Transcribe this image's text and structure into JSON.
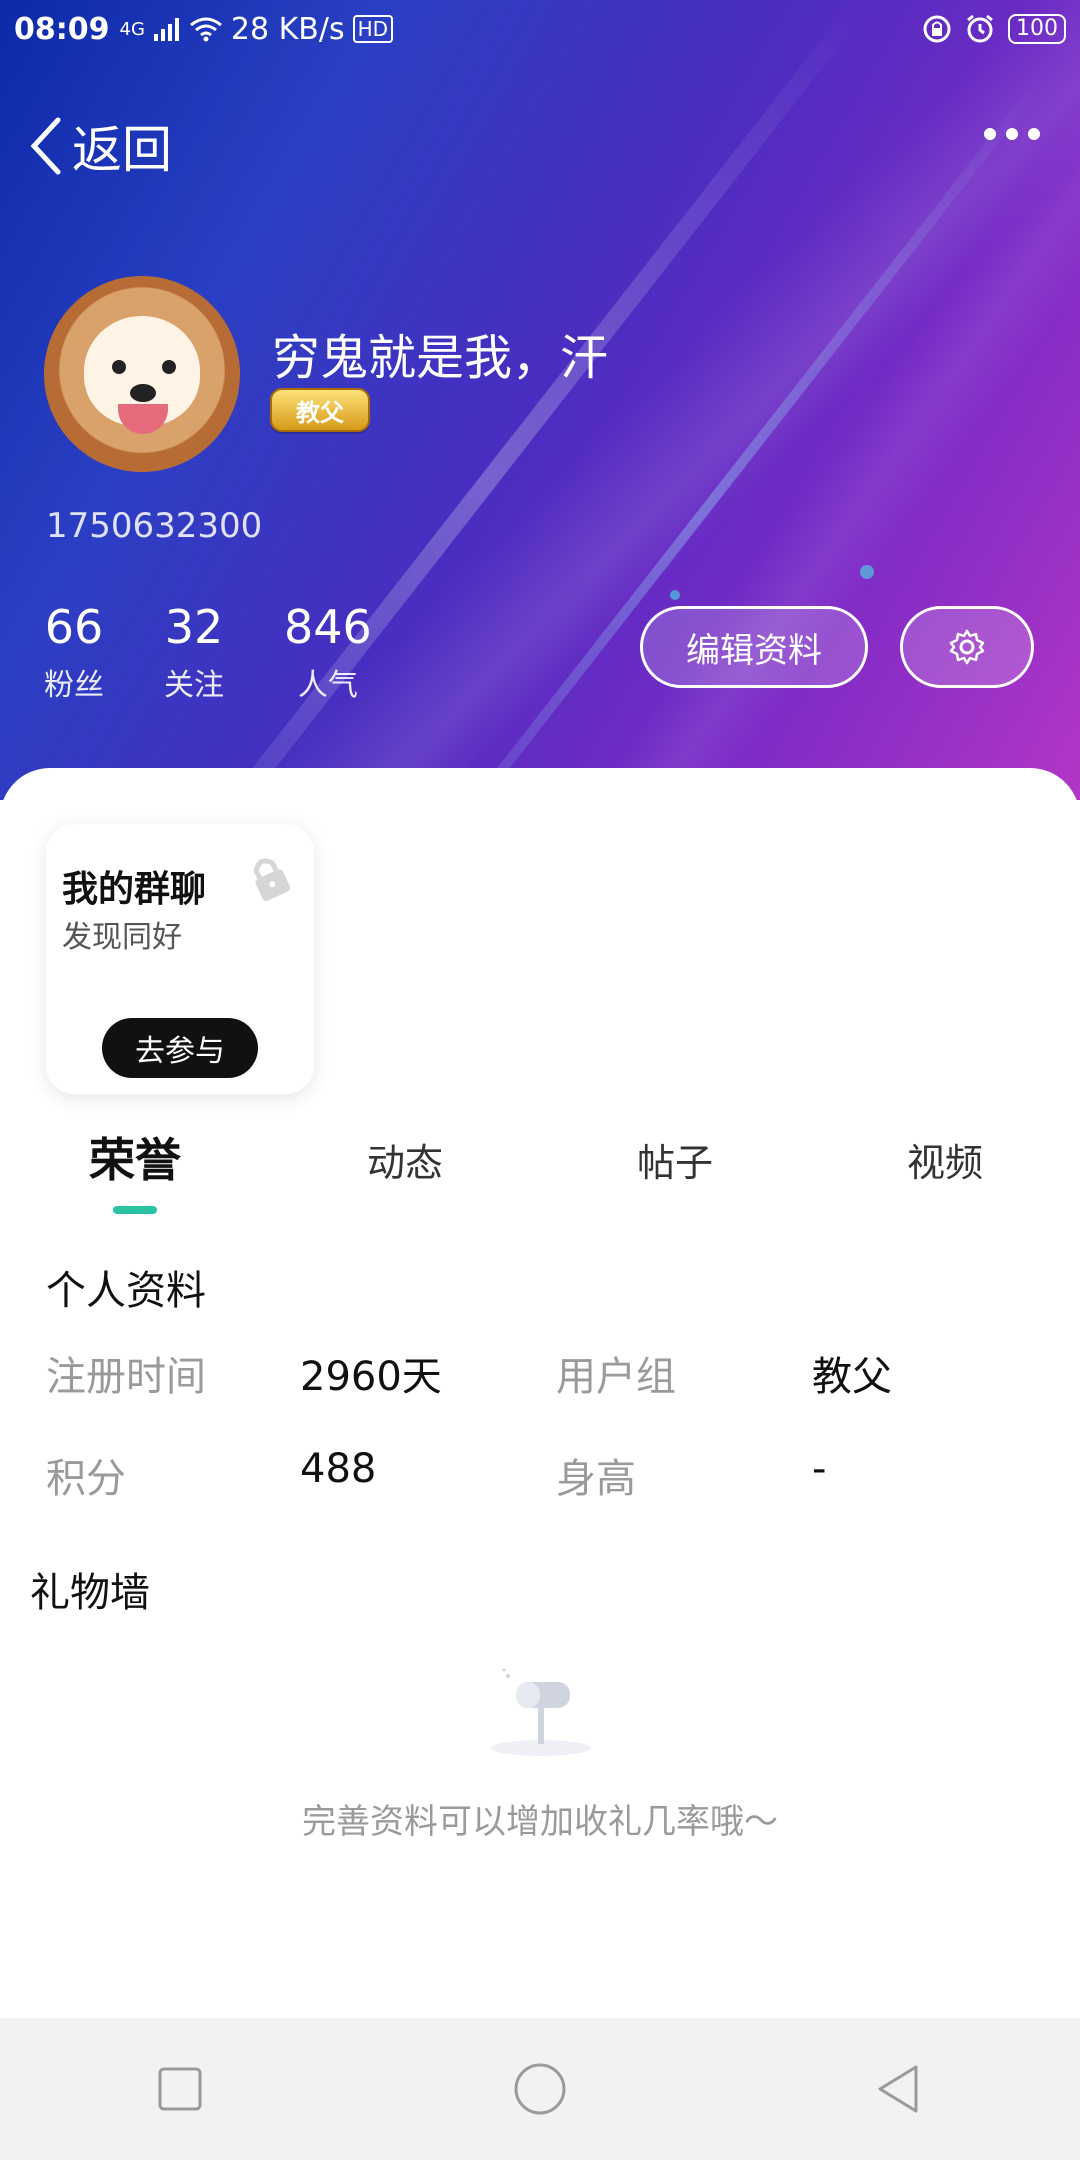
{
  "status": {
    "time": "08:09",
    "network_type": "4G",
    "speed": "28 KB/s",
    "hd": "HD",
    "battery": "100"
  },
  "nav": {
    "back_label": "返回"
  },
  "profile": {
    "name": "穷鬼就是我，汗",
    "badge": "教父",
    "uid": "1750632300",
    "stats": [
      {
        "value": "66",
        "label": "粉丝"
      },
      {
        "value": "32",
        "label": "关注"
      },
      {
        "value": "846",
        "label": "人气"
      }
    ],
    "edit_label": "编辑资料"
  },
  "group_card": {
    "title": "我的群聊",
    "subtitle": "发现同好",
    "join_label": "去参与"
  },
  "tabs": [
    {
      "label": "荣誉"
    },
    {
      "label": "动态"
    },
    {
      "label": "帖子"
    },
    {
      "label": "视频"
    }
  ],
  "profile_info": {
    "title": "个人资料",
    "rows": [
      [
        {
          "k": "注册时间",
          "v": "2960天"
        },
        {
          "k": "用户组",
          "v": "教父"
        }
      ],
      [
        {
          "k": "积分",
          "v": "488"
        },
        {
          "k": "身高",
          "v": "-"
        }
      ]
    ]
  },
  "gift_wall": {
    "title": "礼物墙",
    "empty_tip": "完善资料可以增加收礼几率哦～"
  },
  "colors": {
    "accent": "#29c3a3",
    "badge_gold": "#d59a18"
  }
}
